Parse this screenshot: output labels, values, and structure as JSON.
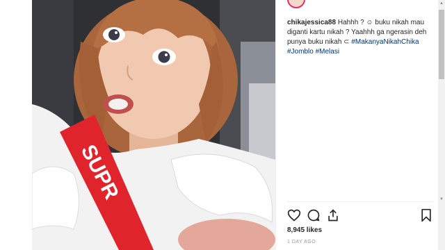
{
  "post": {
    "username": "chikajessica88",
    "caption_text": " Hahhh ? ☺ buku nikah mau diganti kartu nikah ? Yaahhh ga ngerasin deh punya buku nikah ⊂ ",
    "hashtags": [
      "#MakanyaNikahChika",
      "#Jomblo",
      "#Melasi"
    ],
    "likes": "8,945 likes",
    "time_ago": "1 DAY AGO",
    "strap_text": "SUPR"
  },
  "icons": {
    "like": "heart-icon",
    "comment": "comment-icon",
    "share": "share-icon",
    "save": "bookmark-icon"
  },
  "colors": {
    "strap": "#e0242c",
    "hashtag": "#003569",
    "avatar_ring": "#e1306c"
  }
}
